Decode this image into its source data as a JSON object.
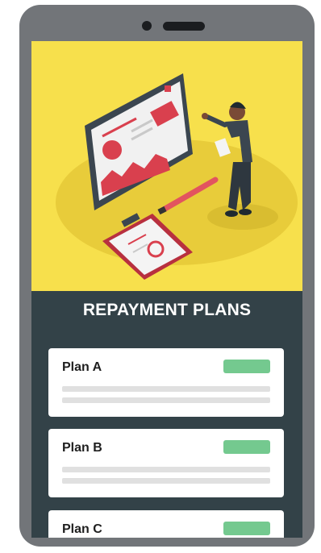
{
  "header": {
    "title": "REPAYMENT PLANS"
  },
  "plans": [
    {
      "name": "Plan A"
    },
    {
      "name": "Plan B"
    },
    {
      "name": "Plan C"
    }
  ],
  "colors": {
    "phone_frame": "#727579",
    "screen_background": "#334248",
    "hero_background": "#f7e04c",
    "badge": "#74c98f"
  },
  "icons": {
    "hero_illustration": "presentation-board-illustration"
  }
}
